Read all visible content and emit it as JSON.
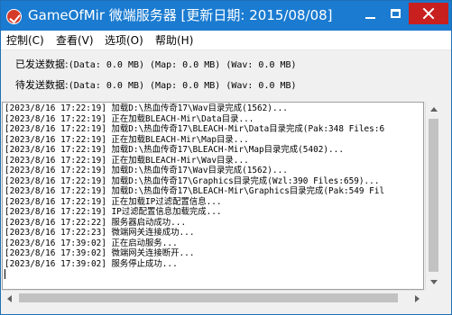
{
  "window": {
    "title": "GameOfMir 微端服务器 [更新日期: 2015/08/08]",
    "icon": "app-logo-icon",
    "controls": [
      "minimize-icon",
      "maximize-icon",
      "close-icon"
    ],
    "colors": {
      "titlebar": "#1a7bd0",
      "close_button": "#c7201e"
    }
  },
  "menu": {
    "items": [
      {
        "label": "控制(C)"
      },
      {
        "label": "查看(V)"
      },
      {
        "label": "选项(O)"
      },
      {
        "label": "帮助(H)"
      }
    ]
  },
  "stats": {
    "sent_label": "已发送数据:",
    "sent_value": "(Data: 0.0 MB) (Map: 0.0 MB) (Wav: 0.0 MB)",
    "pending_label": "待发送数据:",
    "pending_value": "(Data: 0.0 MB) (Map: 0.0 MB) (Wav: 0.0 MB)"
  },
  "log": {
    "lines": [
      "[2023/8/16 17:22:19] 加载D:\\热血传奇17\\Wav目录完成(1562)...",
      "[2023/8/16 17:22:19] 正在加载BLEACH-Mir\\Data目录...",
      "[2023/8/16 17:22:19] 加载D:\\热血传奇17\\BLEACH-Mir\\Data目录完成(Pak:348 Files:6",
      "[2023/8/16 17:22:19] 正在加载BLEACH-Mir\\Map目录...",
      "[2023/8/16 17:22:19] 加载D:\\热血传奇17\\BLEACH-Mir\\Map目录完成(5402)...",
      "[2023/8/16 17:22:19] 正在加载BLEACH-Mir\\Wav目录...",
      "[2023/8/16 17:22:19] 加载D:\\热血传奇17\\Wav目录完成(1562)...",
      "[2023/8/16 17:22:19] 加载D:\\热血传奇17\\Graphics目录完成(Wzl:390 Files:659)...",
      "[2023/8/16 17:22:19] 加载D:\\热血传奇17\\BLEACH-Mir\\Graphics目录完成(Pak:549 Fil",
      "[2023/8/16 17:22:19] 正在加载IP过滤配置信息...",
      "[2023/8/16 17:22:19] IP过滤配置信息加载完成...",
      "[2023/8/16 17:22:22] 服务器启动成功...",
      "[2023/8/16 17:22:23] 微端网关连接成功...",
      "[2023/8/16 17:39:02] 正在启动服务...",
      "[2023/8/16 17:39:02] 微端网关连接断开...",
      "[2023/8/16 17:39:02] 服务停止成功..."
    ]
  }
}
